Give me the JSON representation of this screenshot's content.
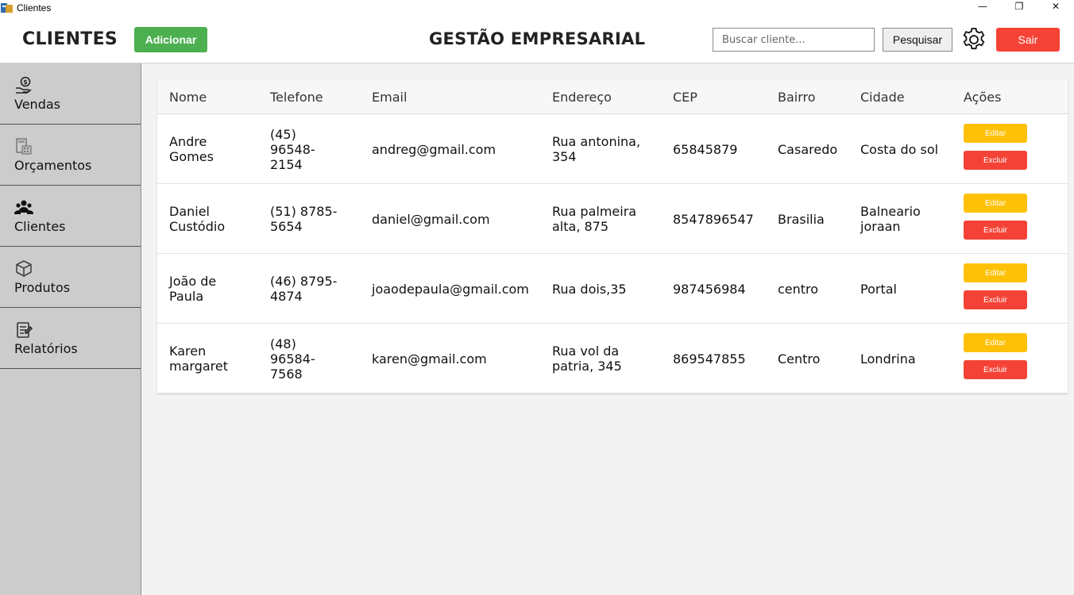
{
  "window": {
    "title": "Clientes",
    "minimize": "—",
    "restore": "❐",
    "close": "✕"
  },
  "header": {
    "title": "CLIENTES",
    "add_label": "Adicionar",
    "company": "GESTÃO EMPRESARIAL",
    "search_placeholder": "Buscar cliente...",
    "search_label": "Pesquisar",
    "exit_label": "Sair",
    "settings_icon": "gear-icon"
  },
  "sidebar": {
    "items": [
      {
        "label": "Vendas",
        "icon": "money-hand-icon"
      },
      {
        "label": "Orçamentos",
        "icon": "calculator-icon"
      },
      {
        "label": "Clientes",
        "icon": "users-icon"
      },
      {
        "label": "Produtos",
        "icon": "box-icon"
      },
      {
        "label": "Relatórios",
        "icon": "report-icon"
      }
    ]
  },
  "table": {
    "columns": [
      "Nome",
      "Telefone",
      "Email",
      "Endereço",
      "CEP",
      "Bairro",
      "Cidade",
      "Ações"
    ],
    "edit_label": "Editar",
    "delete_label": "Excluir",
    "rows": [
      {
        "nome": [
          "Andre",
          "Gomes"
        ],
        "telefone": [
          "(45)",
          "96548-",
          "2154"
        ],
        "email": "andreg@gmail.com",
        "endereco": [
          "Rua antonina,",
          "354"
        ],
        "cep": "65845879",
        "bairro": "Casaredo",
        "cidade": [
          "Costa do sol"
        ]
      },
      {
        "nome": [
          "Daniel",
          "Custódio"
        ],
        "telefone": [
          "(51) 8785-",
          "5654"
        ],
        "email": "daniel@gmail.com",
        "endereco": [
          "Rua palmeira",
          "alta, 875"
        ],
        "cep": "8547896547",
        "bairro": "Brasilia",
        "cidade": [
          "Balneario",
          "joraan"
        ]
      },
      {
        "nome": [
          "João de",
          "Paula"
        ],
        "telefone": [
          "(46) 8795-",
          "4874"
        ],
        "email": "joaodepaula@gmail.com",
        "endereco": [
          "Rua dois,35"
        ],
        "cep": "987456984",
        "bairro": "centro",
        "cidade": [
          "Portal"
        ]
      },
      {
        "nome": [
          "Karen",
          "margaret"
        ],
        "telefone": [
          "(48)",
          "96584-",
          "7568"
        ],
        "email": "karen@gmail.com",
        "endereco": [
          "Rua vol da",
          "patria, 345"
        ],
        "cep": "869547855",
        "bairro": "Centro",
        "cidade": [
          "Londrina"
        ]
      }
    ]
  },
  "colors": {
    "add": "#4caf50",
    "exit": "#f44336",
    "edit": "#ffc107",
    "delete": "#f44336",
    "sidebar": "#cccccc"
  }
}
